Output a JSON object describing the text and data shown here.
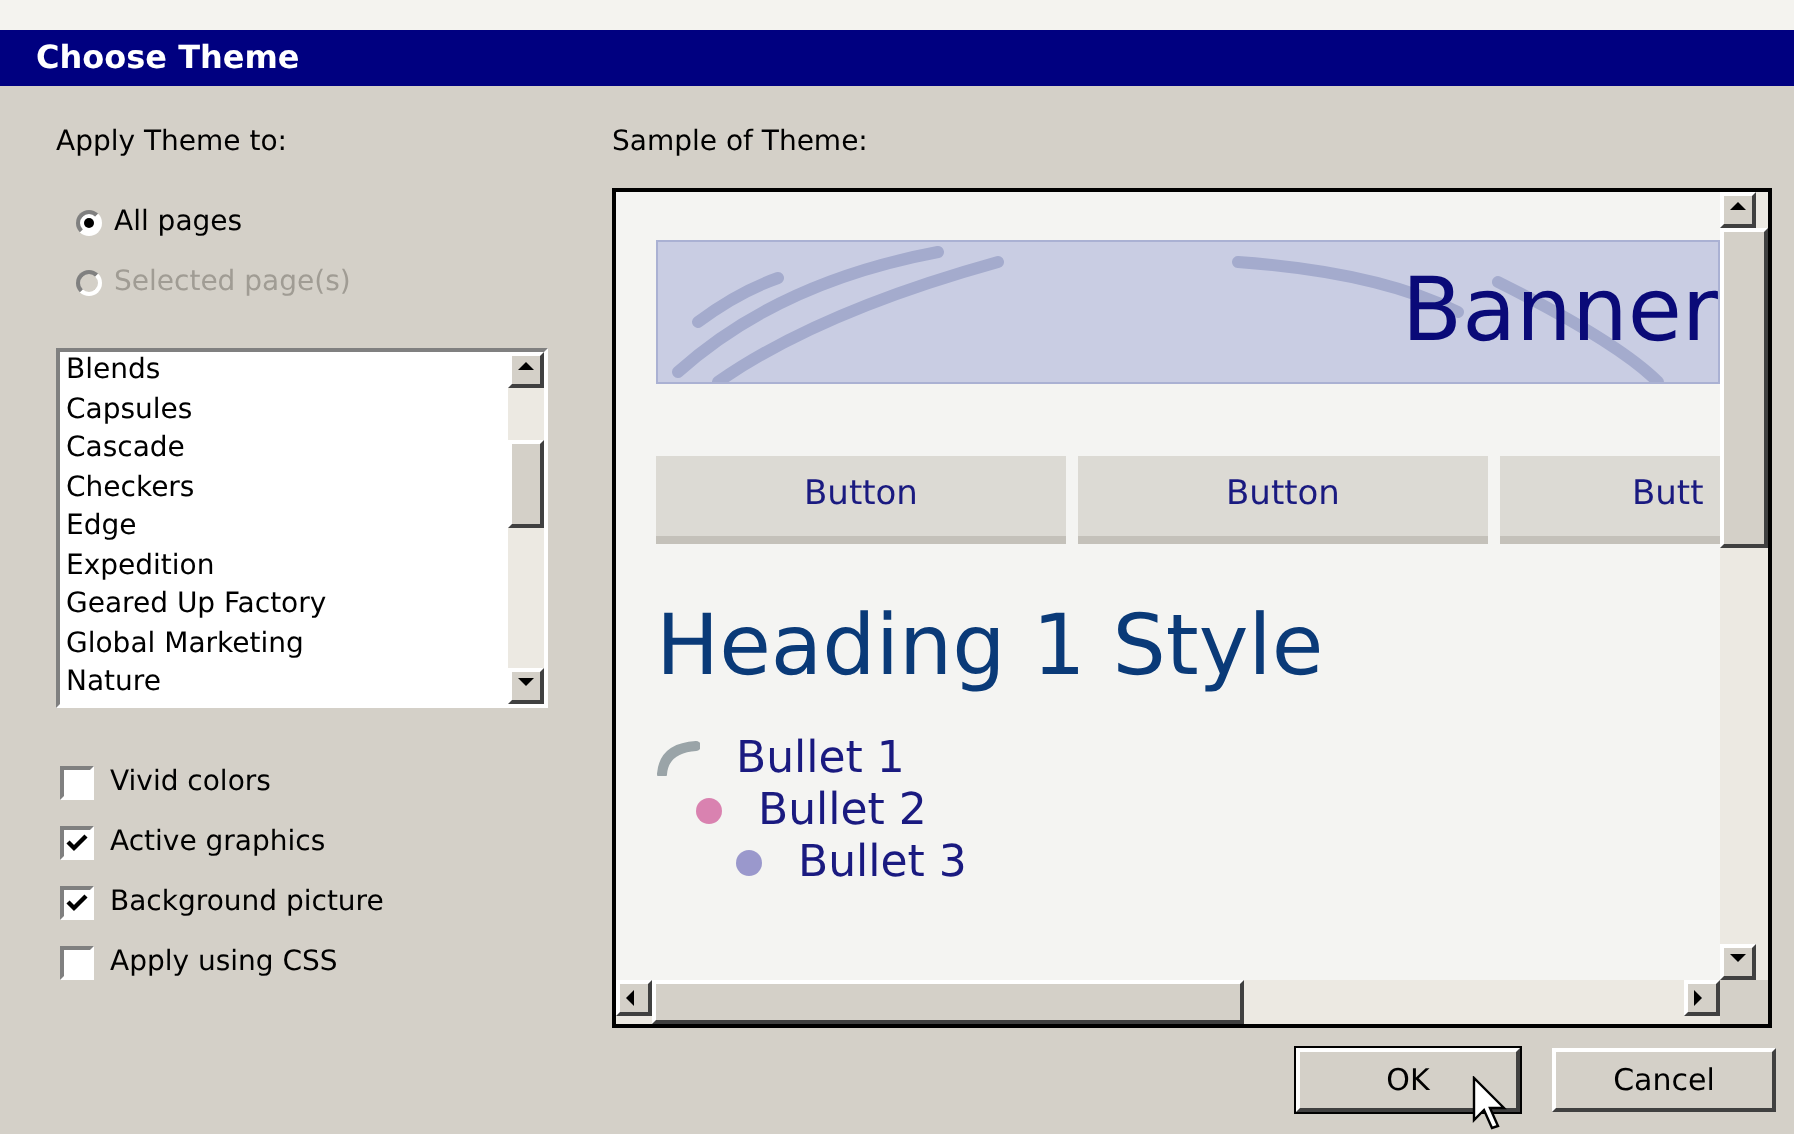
{
  "window": {
    "title": "Choose Theme"
  },
  "apply_label": "Apply Theme to:",
  "apply_options": [
    {
      "label": "All pages",
      "selected": true,
      "disabled": false
    },
    {
      "label": "Selected page(s)",
      "selected": false,
      "disabled": true
    }
  ],
  "theme_list": [
    "Blends",
    "Capsules",
    "Cascade",
    "Checkers",
    "Edge",
    "Expedition",
    "Geared Up Factory",
    "Global Marketing",
    "Nature"
  ],
  "options": [
    {
      "label": "Vivid colors",
      "checked": false
    },
    {
      "label": "Active graphics",
      "checked": true
    },
    {
      "label": "Background picture",
      "checked": true
    },
    {
      "label": "Apply using CSS",
      "checked": false
    }
  ],
  "sample_label": "Sample of Theme:",
  "sample": {
    "banner": "Banner",
    "buttons": [
      "Button",
      "Button",
      "Butt"
    ],
    "heading": "Heading 1 Style",
    "bullets": [
      {
        "text": "Bullet 1",
        "kind": "swoosh",
        "color": "#9aa4a8"
      },
      {
        "text": "Bullet 2",
        "kind": "dot",
        "color": "#d982b0"
      },
      {
        "text": "Bullet 3",
        "kind": "dot",
        "color": "#9a98cc"
      }
    ]
  },
  "buttons": [
    "OK",
    "Cancel"
  ]
}
